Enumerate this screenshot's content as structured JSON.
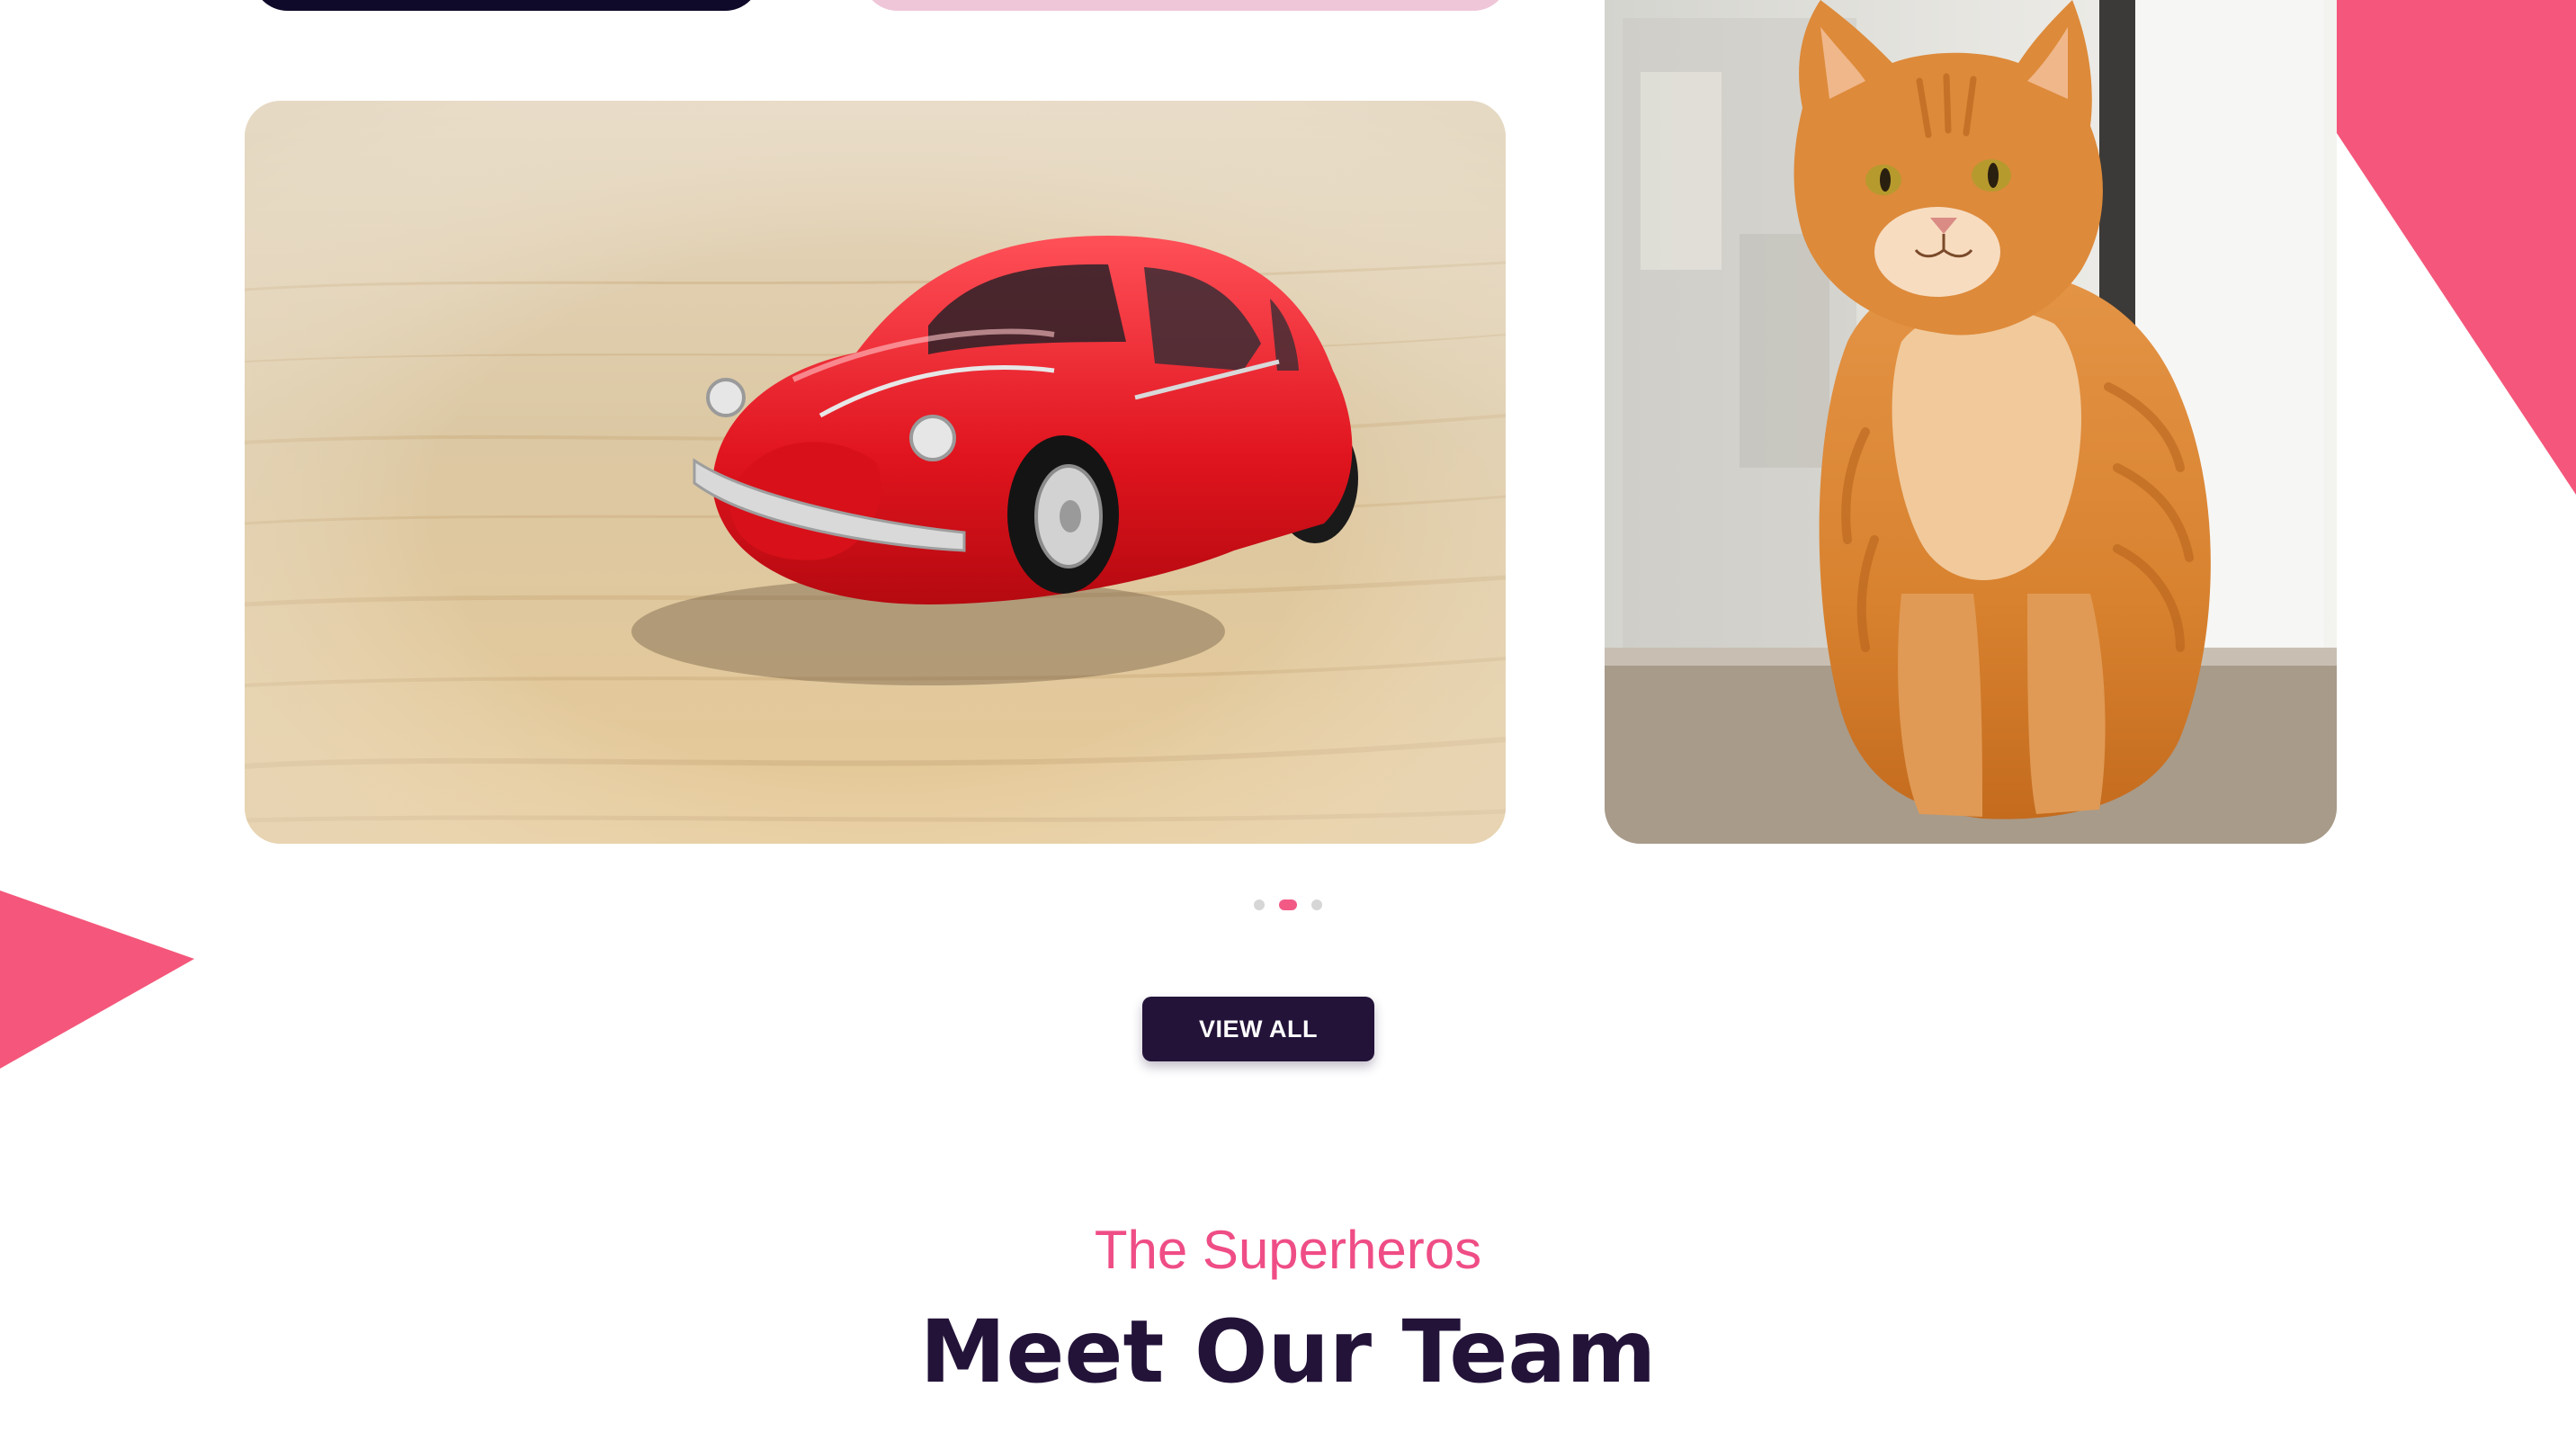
{
  "colors": {
    "accent_pink": "#f4577b",
    "dark_navy": "#231339",
    "subtitle_pink": "#ef4d86"
  },
  "gallery": {
    "images": [
      {
        "name": "red toy car"
      },
      {
        "name": "orange tabby cat"
      }
    ],
    "carousel": {
      "total": 3,
      "active_index": 1
    },
    "view_all_label": "VIEW ALL"
  },
  "team_section": {
    "subtitle": "The Superheros",
    "title": "Meet Our Team"
  }
}
